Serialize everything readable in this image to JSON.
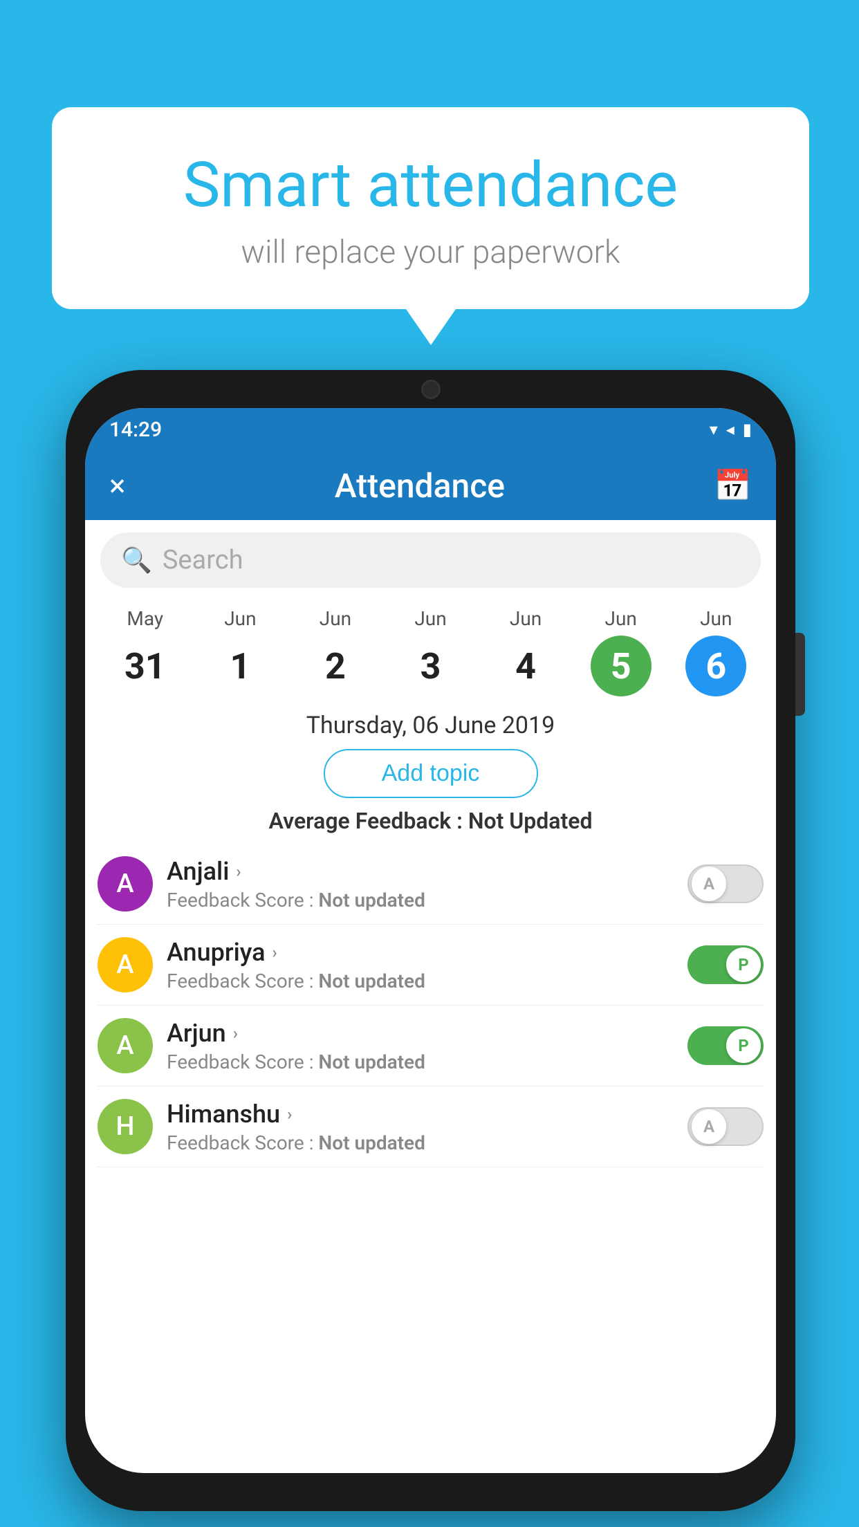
{
  "background_color": "#29b6e8",
  "bubble": {
    "title": "Smart attendance",
    "subtitle": "will replace your paperwork"
  },
  "phone": {
    "status_bar": {
      "time": "14:29",
      "icons": [
        "▾",
        "◂",
        "▮"
      ]
    },
    "app_bar": {
      "close_label": "×",
      "title": "Attendance",
      "calendar_icon": "📅"
    },
    "search": {
      "placeholder": "Search"
    },
    "calendar": {
      "days": [
        {
          "month": "May",
          "num": "31",
          "style": "normal"
        },
        {
          "month": "Jun",
          "num": "1",
          "style": "normal"
        },
        {
          "month": "Jun",
          "num": "2",
          "style": "normal"
        },
        {
          "month": "Jun",
          "num": "3",
          "style": "normal"
        },
        {
          "month": "Jun",
          "num": "4",
          "style": "normal"
        },
        {
          "month": "Jun",
          "num": "5",
          "style": "green"
        },
        {
          "month": "Jun",
          "num": "6",
          "style": "blue"
        }
      ]
    },
    "selected_date": "Thursday, 06 June 2019",
    "add_topic_label": "Add topic",
    "avg_feedback_label": "Average Feedback :",
    "avg_feedback_value": "Not Updated",
    "students": [
      {
        "name": "Anjali",
        "avatar_letter": "A",
        "avatar_color": "#9c27b0",
        "feedback_label": "Feedback Score :",
        "feedback_value": "Not updated",
        "toggle_state": "off",
        "toggle_letter": "A"
      },
      {
        "name": "Anupriya",
        "avatar_letter": "A",
        "avatar_color": "#ffc107",
        "feedback_label": "Feedback Score :",
        "feedback_value": "Not updated",
        "toggle_state": "on",
        "toggle_letter": "P"
      },
      {
        "name": "Arjun",
        "avatar_letter": "A",
        "avatar_color": "#8bc34a",
        "feedback_label": "Feedback Score :",
        "feedback_value": "Not updated",
        "toggle_state": "on",
        "toggle_letter": "P"
      },
      {
        "name": "Himanshu",
        "avatar_letter": "H",
        "avatar_color": "#8bc34a",
        "feedback_label": "Feedback Score :",
        "feedback_value": "Not updated",
        "toggle_state": "off",
        "toggle_letter": "A"
      }
    ]
  }
}
